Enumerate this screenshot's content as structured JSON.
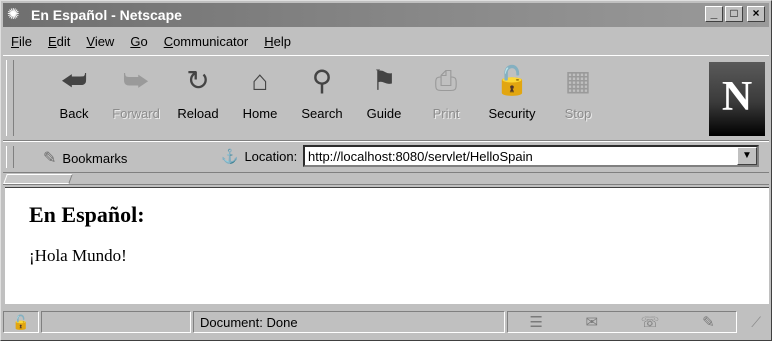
{
  "window": {
    "title": "En Español - Netscape",
    "controls": [
      "_",
      "□",
      "×"
    ]
  },
  "menu": [
    {
      "label": "File",
      "mnemonic": "F",
      "rest": "ile"
    },
    {
      "label": "Edit",
      "mnemonic": "E",
      "rest": "dit"
    },
    {
      "label": "View",
      "mnemonic": "V",
      "rest": "iew"
    },
    {
      "label": "Go",
      "mnemonic": "G",
      "rest": "o"
    },
    {
      "label": "Communicator",
      "mnemonic": "C",
      "rest": "ommunicator"
    },
    {
      "label": "Help",
      "mnemonic": "H",
      "rest": "elp"
    }
  ],
  "toolbar": {
    "buttons": [
      {
        "label": "Back",
        "icon": "back-arrow-icon",
        "glyph": "⮨",
        "enabled": true
      },
      {
        "label": "Forward",
        "icon": "forward-arrow-icon",
        "glyph": "⮩",
        "enabled": false
      },
      {
        "label": "Reload",
        "icon": "reload-icon",
        "glyph": "↻",
        "enabled": true
      },
      {
        "label": "Home",
        "icon": "home-icon",
        "glyph": "⌂",
        "enabled": true
      },
      {
        "label": "Search",
        "icon": "search-icon",
        "glyph": "⚲",
        "enabled": true
      },
      {
        "label": "Guide",
        "icon": "guide-icon",
        "glyph": "⚑",
        "enabled": true
      },
      {
        "label": "Print",
        "icon": "print-icon",
        "glyph": "⎙",
        "enabled": false
      },
      {
        "label": "Security",
        "icon": "security-lock-icon",
        "glyph": "🔓",
        "enabled": true
      },
      {
        "label": "Stop",
        "icon": "stop-icon",
        "glyph": "▦",
        "enabled": false
      }
    ],
    "logo": "N"
  },
  "location_bar": {
    "bookmarks_label": "Bookmarks",
    "location_label": "Location:",
    "url": "http://localhost:8080/servlet/HelloSpain"
  },
  "page": {
    "heading": "En Español:",
    "body": "¡Hola Mundo!"
  },
  "status_bar": {
    "status": "Document: Done"
  }
}
